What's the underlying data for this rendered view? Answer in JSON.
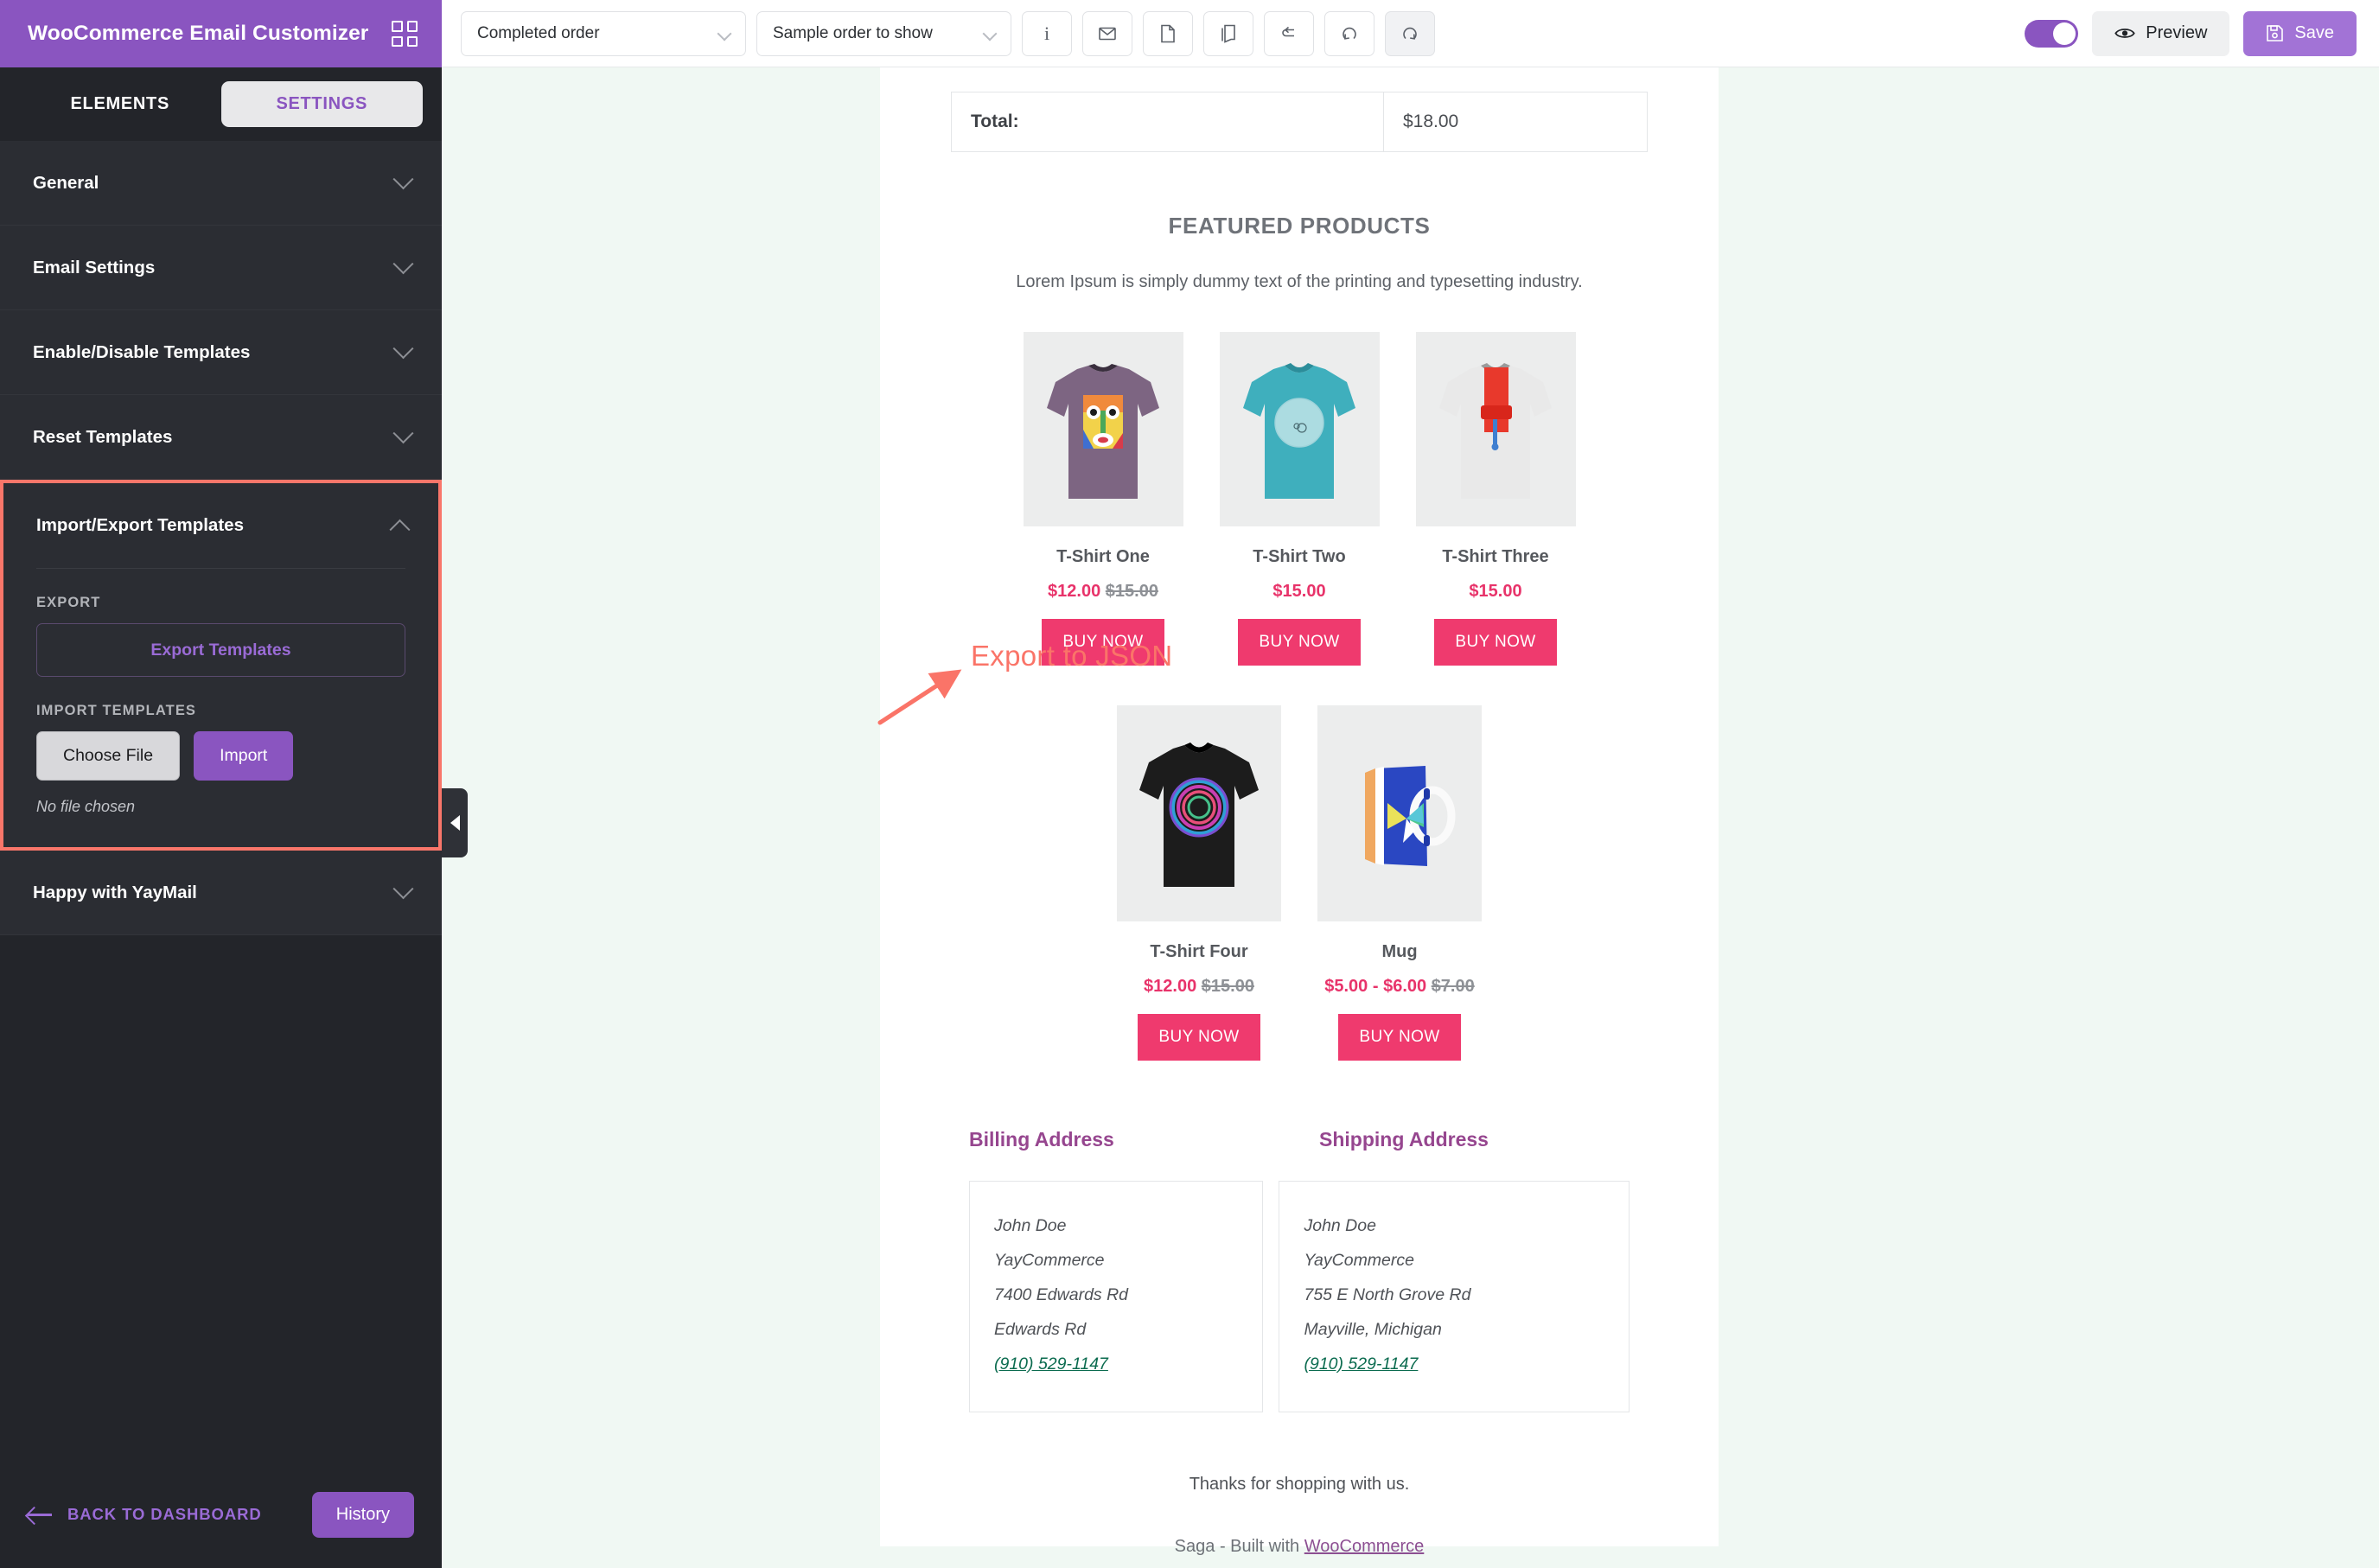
{
  "sidebar": {
    "brand_title": "WooCommerce Email Customizer",
    "grid_icon": "grid-icon",
    "tabs": [
      {
        "label": "ELEMENTS",
        "active": false
      },
      {
        "label": "SETTINGS",
        "active": true
      }
    ],
    "accordion": [
      {
        "label": "General",
        "expanded": false
      },
      {
        "label": "Email Settings",
        "expanded": false
      },
      {
        "label": "Enable/Disable Templates",
        "expanded": false
      },
      {
        "label": "Reset Templates",
        "expanded": false
      },
      {
        "label": "Import/Export Templates",
        "expanded": true
      },
      {
        "label": "Happy with YayMail",
        "expanded": false
      }
    ],
    "import_export": {
      "export_label": "EXPORT",
      "export_button": "Export Templates",
      "import_label": "IMPORT TEMPLATES",
      "choose_file_button": "Choose File",
      "import_button": "Import",
      "file_status": "No file chosen"
    },
    "footer": {
      "back_label": "BACK TO DASHBOARD",
      "back_icon": "arrow-left-icon",
      "history_label": "History"
    },
    "collapse_handle_icon": "chevron-left-icon"
  },
  "topbar": {
    "template_select": {
      "value": "Completed order",
      "caret": "chevron-down-icon"
    },
    "sample_select": {
      "value": "Sample order to show",
      "caret": "chevron-down-icon"
    },
    "tools": [
      {
        "name": "info-icon",
        "glyph": "i",
        "active": false
      },
      {
        "name": "envelope-icon",
        "glyph": "envelope",
        "active": false
      },
      {
        "name": "page-icon",
        "glyph": "page",
        "active": false
      },
      {
        "name": "duplicate-icon",
        "glyph": "duplicate",
        "active": false
      },
      {
        "name": "reset-icon",
        "glyph": "reset",
        "active": false
      },
      {
        "name": "undo-icon",
        "glyph": "undo",
        "active": false
      },
      {
        "name": "redo-icon",
        "glyph": "redo",
        "active": true
      }
    ],
    "toggle": {
      "name": "desktop-mobile-toggle",
      "on": true
    },
    "preview_label": "Preview",
    "preview_icon": "eye-icon",
    "save_label": "Save",
    "save_icon": "floppy-disk-icon"
  },
  "email": {
    "totals": {
      "label": "Total:",
      "value": "$18.00"
    },
    "featured_heading": "FEATURED PRODUCTS",
    "featured_subtitle": "Lorem Ipsum is simply dummy text of the printing and typesetting industry.",
    "products_row1": [
      {
        "name": "T-Shirt One",
        "price": "$12.00",
        "old_price": "$15.00",
        "cta": "BUY NOW",
        "image": "purple-graphic-tshirt"
      },
      {
        "name": "T-Shirt Two",
        "price": "$15.00",
        "old_price": "",
        "cta": "BUY NOW",
        "image": "teal-tshirt"
      },
      {
        "name": "T-Shirt Three",
        "price": "$15.00",
        "old_price": "",
        "cta": "BUY NOW",
        "image": "white-tshirt-paint-roller"
      }
    ],
    "products_row2": [
      {
        "name": "T-Shirt Four",
        "price": "$12.00",
        "old_price": "$15.00",
        "cta": "BUY NOW",
        "image": "black-swirl-tshirt"
      },
      {
        "name": "Mug",
        "price": "$5.00 - $6.00",
        "old_price": "$7.00",
        "cta": "BUY NOW",
        "image": "blue-mug"
      }
    ],
    "billing": {
      "heading": "Billing Address",
      "lines": [
        "John Doe",
        "YayCommerce",
        "7400 Edwards Rd",
        "Edwards Rd"
      ],
      "phone": "(910) 529-1147"
    },
    "shipping": {
      "heading": "Shipping Address",
      "lines": [
        "John Doe",
        "YayCommerce",
        "755 E North Grove Rd",
        "Mayville, Michigan"
      ],
      "phone": "(910) 529-1147"
    },
    "thanks": "Thanks for shopping with us.",
    "footer_prefix": "Saga - Built with ",
    "footer_link": "WooCommerce"
  },
  "annotation": {
    "text": "Export to JSON",
    "color": "#fa7468"
  },
  "colors": {
    "brand_purple": "#8a55c0",
    "sidebar_dark": "#23252a",
    "panel_dark": "#2b2d33",
    "accent_pink": "#ef3a6e",
    "price_pink": "#e8336a",
    "highlight_red": "#f9766a",
    "canvas_mint": "#f0f8f3",
    "link_green": "#0b6b4f",
    "heading_plum": "#96468f"
  }
}
